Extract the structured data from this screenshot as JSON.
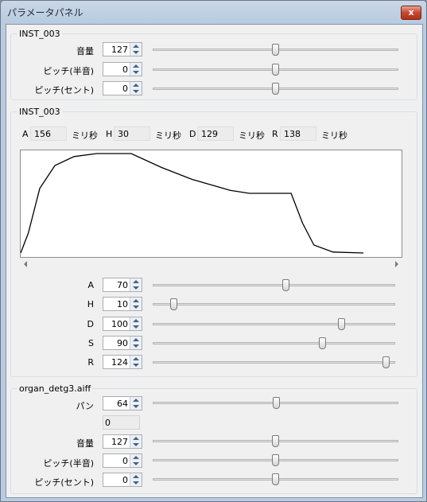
{
  "window": {
    "title": "パラメータパネル",
    "close_glyph": "x"
  },
  "group1": {
    "title": "INST_003",
    "rows": [
      {
        "label": "音量",
        "value": "127",
        "level": 0.5
      },
      {
        "label": "ピッチ(半音)",
        "value": "0",
        "level": 0.5
      },
      {
        "label": "ピッチ(セント)",
        "value": "0",
        "level": 0.5
      }
    ]
  },
  "group2": {
    "title": "INST_003",
    "adsr": [
      {
        "key": "A",
        "value": "156",
        "unit": "ミリ秒"
      },
      {
        "key": "H",
        "value": "30",
        "unit": "ミリ秒"
      },
      {
        "key": "D",
        "value": "129",
        "unit": "ミリ秒"
      },
      {
        "key": "R",
        "value": "138",
        "unit": "ミリ秒"
      }
    ],
    "envelope_points": [
      [
        0,
        0
      ],
      [
        0.02,
        0.2
      ],
      [
        0.05,
        0.65
      ],
      [
        0.09,
        0.88
      ],
      [
        0.14,
        0.97
      ],
      [
        0.2,
        1.0
      ],
      [
        0.29,
        1.0
      ],
      [
        0.37,
        0.86
      ],
      [
        0.45,
        0.74
      ],
      [
        0.55,
        0.63
      ],
      [
        0.6,
        0.6
      ],
      [
        0.71,
        0.6
      ],
      [
        0.74,
        0.3
      ],
      [
        0.77,
        0.08
      ],
      [
        0.82,
        0.01
      ],
      [
        0.9,
        0.0
      ]
    ],
    "rows": [
      {
        "label": "A",
        "value": "70",
        "level": 0.55
      },
      {
        "label": "H",
        "value": "10",
        "level": 0.08
      },
      {
        "label": "D",
        "value": "100",
        "level": 0.78
      },
      {
        "label": "S",
        "value": "90",
        "level": 0.71
      },
      {
        "label": "R",
        "value": "124",
        "level": 0.98
      }
    ]
  },
  "group3": {
    "title": "organ_detg3.aiff",
    "pan": {
      "label": "パン",
      "value": "64",
      "level": 0.5,
      "readout": "0"
    },
    "rows": [
      {
        "label": "音量",
        "value": "127",
        "level": 0.5
      },
      {
        "label": "ピッチ(半音)",
        "value": "0",
        "level": 0.5
      },
      {
        "label": "ピッチ(セント)",
        "value": "0",
        "level": 0.5
      }
    ]
  }
}
